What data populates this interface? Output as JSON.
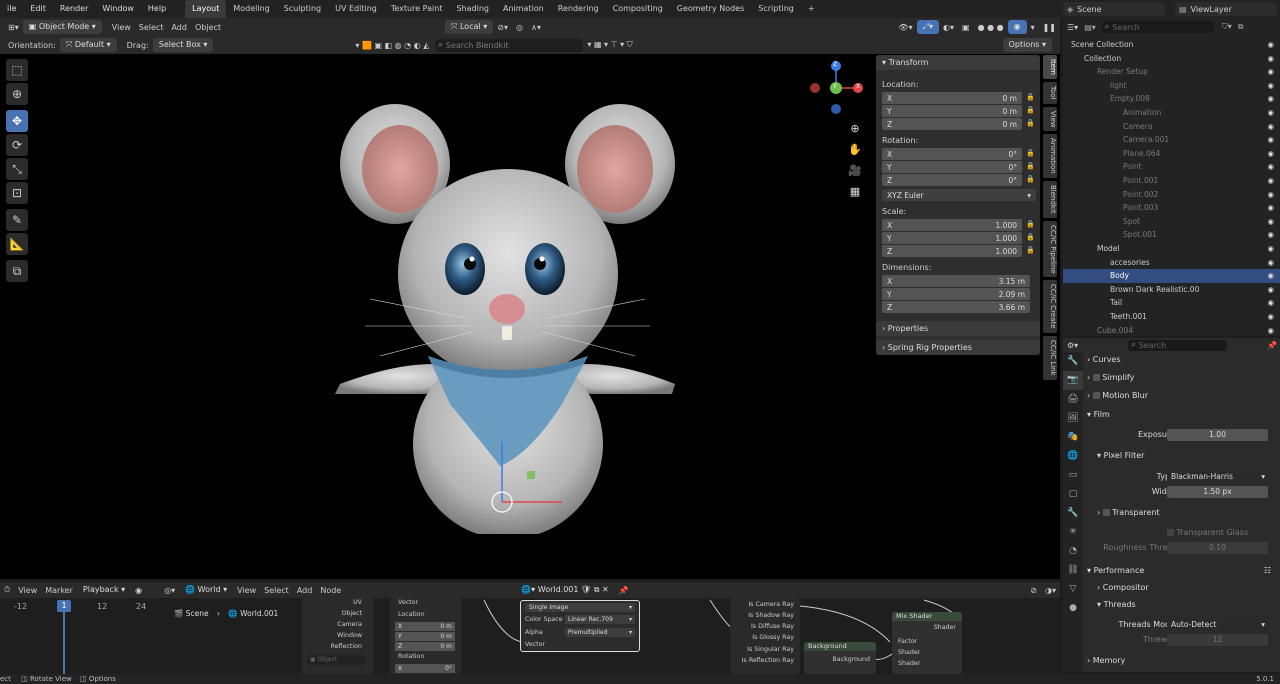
{
  "topbar": {
    "menus": [
      "ile",
      "Edit",
      "Render",
      "Window",
      "Help"
    ],
    "workspaces": [
      "Layout",
      "Modeling",
      "Sculpting",
      "UV Editing",
      "Texture Paint",
      "Shading",
      "Animation",
      "Rendering",
      "Compositing",
      "Geometry Nodes",
      "Scripting"
    ],
    "active_workspace": "Layout",
    "add_tab": "+",
    "scene": "Scene",
    "view_layer": "ViewLayer"
  },
  "viewport_header": {
    "mode": "Object Mode",
    "menus": [
      "View",
      "Select",
      "Add",
      "Object"
    ],
    "orientation_value": "Local"
  },
  "tool_header": {
    "orientation_label": "Orientation:",
    "orientation": "Default",
    "drag_label": "Drag:",
    "drag": "Select Box",
    "search_placeholder": "Search Blendkit",
    "options": "Options"
  },
  "gizmo": {
    "z": "Z",
    "y": "Y",
    "x": "X"
  },
  "npanel": {
    "transform_title": "Transform",
    "location_label": "Location:",
    "location": [
      {
        "axis": "X",
        "value": "0 m"
      },
      {
        "axis": "Y",
        "value": "0 m"
      },
      {
        "axis": "Z",
        "value": "0 m"
      }
    ],
    "rotation_label": "Rotation:",
    "rotation": [
      {
        "axis": "X",
        "value": "0°"
      },
      {
        "axis": "Y",
        "value": "0°"
      },
      {
        "axis": "Z",
        "value": "0°"
      }
    ],
    "rotation_mode": "XYZ Euler",
    "scale_label": "Scale:",
    "scale": [
      {
        "axis": "X",
        "value": "1.000"
      },
      {
        "axis": "Y",
        "value": "1.000"
      },
      {
        "axis": "Z",
        "value": "1.000"
      }
    ],
    "dimensions_label": "Dimensions:",
    "dimensions": [
      {
        "axis": "X",
        "value": "3.15 m"
      },
      {
        "axis": "Y",
        "value": "2.09 m"
      },
      {
        "axis": "Z",
        "value": "3.66 m"
      }
    ],
    "properties": "Properties",
    "spring": "Spring Rig Properties"
  },
  "vtabs": [
    "Item",
    "Tool",
    "View",
    "Animation",
    "Blendkit",
    "CC/IC Pipeline",
    "CC/IC Create",
    "CC/IC Link"
  ],
  "outliner": {
    "search_placeholder": "Search",
    "rows": [
      {
        "indent": 0,
        "label": "Scene Collection",
        "cls": ""
      },
      {
        "indent": 1,
        "label": "Collection",
        "cls": ""
      },
      {
        "indent": 2,
        "label": "Render Setup",
        "cls": "dim"
      },
      {
        "indent": 3,
        "label": "light",
        "cls": "dim"
      },
      {
        "indent": 3,
        "label": "Empty.008",
        "cls": "dim"
      },
      {
        "indent": 4,
        "label": "Animation",
        "cls": "dim"
      },
      {
        "indent": 4,
        "label": "Camera",
        "cls": "dim"
      },
      {
        "indent": 4,
        "label": "Camera.001",
        "cls": "dim"
      },
      {
        "indent": 4,
        "label": "Plane.064",
        "cls": "dim"
      },
      {
        "indent": 4,
        "label": "Point",
        "cls": "dim"
      },
      {
        "indent": 4,
        "label": "Point.001",
        "cls": "dim"
      },
      {
        "indent": 4,
        "label": "Point.002",
        "cls": "dim"
      },
      {
        "indent": 4,
        "label": "Point.003",
        "cls": "dim"
      },
      {
        "indent": 4,
        "label": "Spot",
        "cls": "dim"
      },
      {
        "indent": 4,
        "label": "Spot.001",
        "cls": "dim"
      },
      {
        "indent": 2,
        "label": "Model",
        "cls": ""
      },
      {
        "indent": 3,
        "label": "accesories",
        "cls": ""
      },
      {
        "indent": 3,
        "label": "Body",
        "cls": "sel"
      },
      {
        "indent": 3,
        "label": "Brown Dark Realistic.00",
        "cls": ""
      },
      {
        "indent": 3,
        "label": "Tail",
        "cls": ""
      },
      {
        "indent": 3,
        "label": "Teeth.001",
        "cls": ""
      },
      {
        "indent": 2,
        "label": "Cube.004",
        "cls": "dim"
      }
    ]
  },
  "props": {
    "search_placeholder": "Search",
    "curves": "Curves",
    "simplify": "Simplify",
    "motion_blur": "Motion Blur",
    "film": "Film",
    "exposure_label": "Exposure",
    "exposure": "1.00",
    "pixel_filter": "Pixel Filter",
    "type_label": "Type",
    "type": "Blackman-Harris",
    "width_label": "Width",
    "width": "1.50 px",
    "transparent": "Transparent",
    "transparent_glass": "Transparent Glass",
    "roughness_label": "Roughness Thre...",
    "roughness": "0.10",
    "performance": "Performance",
    "compositor": "Compositor",
    "threads": "Threads",
    "threads_mode_label": "Threads Mode",
    "threads_mode": "Auto-Detect",
    "threads_label": "Threads",
    "threads_value": "12",
    "memory": "Memory"
  },
  "timeline": {
    "menus": [
      "View",
      "Marker",
      "Playback"
    ],
    "ticks": [
      "-12",
      "1",
      "12",
      "24"
    ],
    "current": "1"
  },
  "node_editor": {
    "world_label": "World",
    "menus": [
      "View",
      "Select",
      "Add",
      "Node"
    ],
    "world_name": "World.001",
    "breadcrumb_scene": "Scene",
    "breadcrumb_world": "World.001",
    "tex_outputs": [
      "UV",
      "Object",
      "Camera",
      "Window",
      "Reflection"
    ],
    "object_field": "Object",
    "mapping": [
      "Vector",
      "Location",
      "X",
      "Y",
      "Z",
      "Rotation",
      "X"
    ],
    "mapping_vals": [
      "0 m",
      "0 m",
      "0 m",
      "0°"
    ],
    "image_node": {
      "interp": "Single Image",
      "cs_label": "Color Space",
      "cs": "Linear Rec.709",
      "alpha_label": "Alpha",
      "alpha": "Premultiplied",
      "vector": "Vector"
    },
    "lightpath": [
      "Is Camera Ray",
      "Is Shadow Ray",
      "Is Diffuse Ray",
      "Is Glossy Ray",
      "Is Singular Ray",
      "Is Reflection Ray"
    ],
    "background": {
      "title": "Background",
      "out": "Background"
    },
    "mix": {
      "title": "Mix Shader",
      "shader_out": "Shader",
      "factor": "Factor",
      "shader1": "Shader",
      "shader2": "Shader"
    }
  },
  "status": {
    "left": "ect",
    "rotate": "Rotate View",
    "options": "Options",
    "version": "5.0.1"
  }
}
